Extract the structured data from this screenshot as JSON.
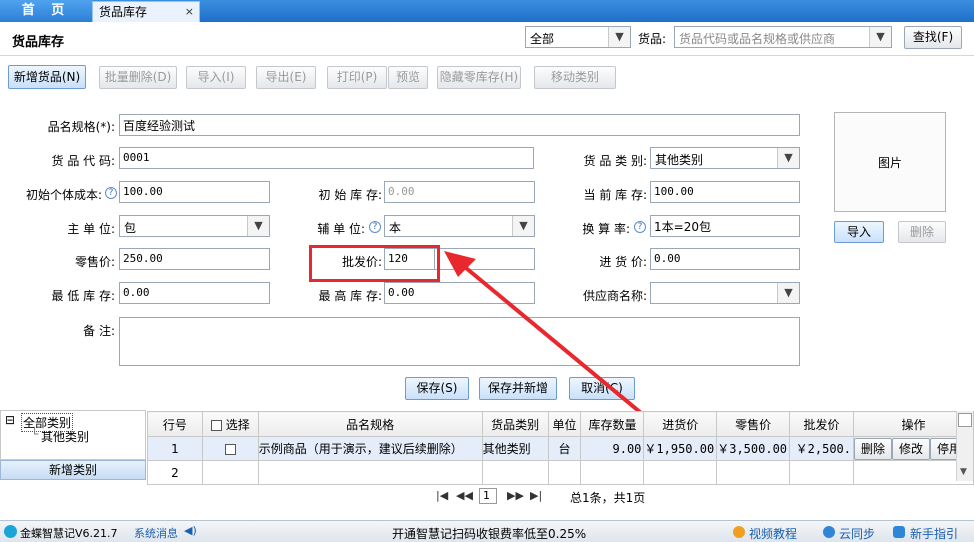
{
  "tabs": {
    "home": "首 页",
    "inventory": "货品库存",
    "close": "×"
  },
  "header": {
    "title": "货品库存",
    "category_filter": "全部",
    "goods_label": "货品:",
    "search_placeholder": "货品代码或品名规格或供应商",
    "search_button": "查找(F)"
  },
  "toolbar": {
    "add": "新增货品(N)",
    "batch_delete": "批量删除(D)",
    "import": "导入(I)",
    "export": "导出(E)",
    "print": "打印(P)",
    "preview": "预览",
    "hide_zero": "隐藏零库存(H)",
    "move_category": "移动类别"
  },
  "form": {
    "name_label": "品名规格(*):",
    "name_value": "百度经验测试",
    "code_label": "货 品 代 码:",
    "code_value": "0001",
    "category_label": "货 品 类 别:",
    "category_value": "其他类别",
    "init_cost_label": "初始个体成本:",
    "init_cost_value": "100.00",
    "init_stock_label": "初 始 库 存:",
    "init_stock_value": "0.00",
    "current_stock_label": "当 前 库 存:",
    "current_stock_value": "100.00",
    "main_unit_label": "主  单  位:",
    "main_unit_value": "包",
    "sub_unit_label": "辅 单 位:",
    "sub_unit_value": "本",
    "ratio_label": "换 算 率:",
    "ratio_value": "1本=20包",
    "retail_label": "零售价:",
    "retail_value": "250.00",
    "wholesale_label": "批发价:",
    "wholesale_value": "120",
    "purchase_label": "进  货  价:",
    "purchase_value": "0.00",
    "min_stock_label": "最 低 库 存:",
    "min_stock_value": "0.00",
    "max_stock_label": "最 高 库 存:",
    "max_stock_value": "0.00",
    "supplier_label": "供应商名称:",
    "supplier_value": "",
    "remark_label": "备    注:",
    "remark_value": "",
    "image_label": "图片",
    "image_import": "导入",
    "image_delete": "删除",
    "help": "?",
    "save": "保存(S)",
    "save_new": "保存并新增",
    "cancel": "取消(C)"
  },
  "tree": {
    "root": "全部类别",
    "child": "其他类别",
    "add_category": "新增类别",
    "root_toggle": "⊟"
  },
  "grid": {
    "headers": [
      "行号",
      "选择",
      "品名规格",
      "货品类别",
      "单位",
      "库存数量",
      "进货价",
      "零售价",
      "批发价",
      "操作"
    ],
    "rows": [
      {
        "no": "1",
        "name": "示例商品（用于演示，建议后续删除）",
        "category": "其他类别",
        "unit": "台",
        "qty": "9.00",
        "purchase": "￥1,950.00",
        "retail": "￥3,500.00",
        "wholesale": "￥2,500.",
        "ops": [
          "删除",
          "修改",
          "停用"
        ]
      },
      {
        "no": "2"
      }
    ]
  },
  "pager": {
    "page": "1",
    "summary": "总1条，共1页"
  },
  "status": {
    "app": "金蝶智慧记V6.21.7",
    "messages": "系统消息",
    "promo": "开通智慧记扫码收银费率低至0.25%",
    "video": "视频教程",
    "sync": "云同步",
    "guide": "新手指引"
  }
}
